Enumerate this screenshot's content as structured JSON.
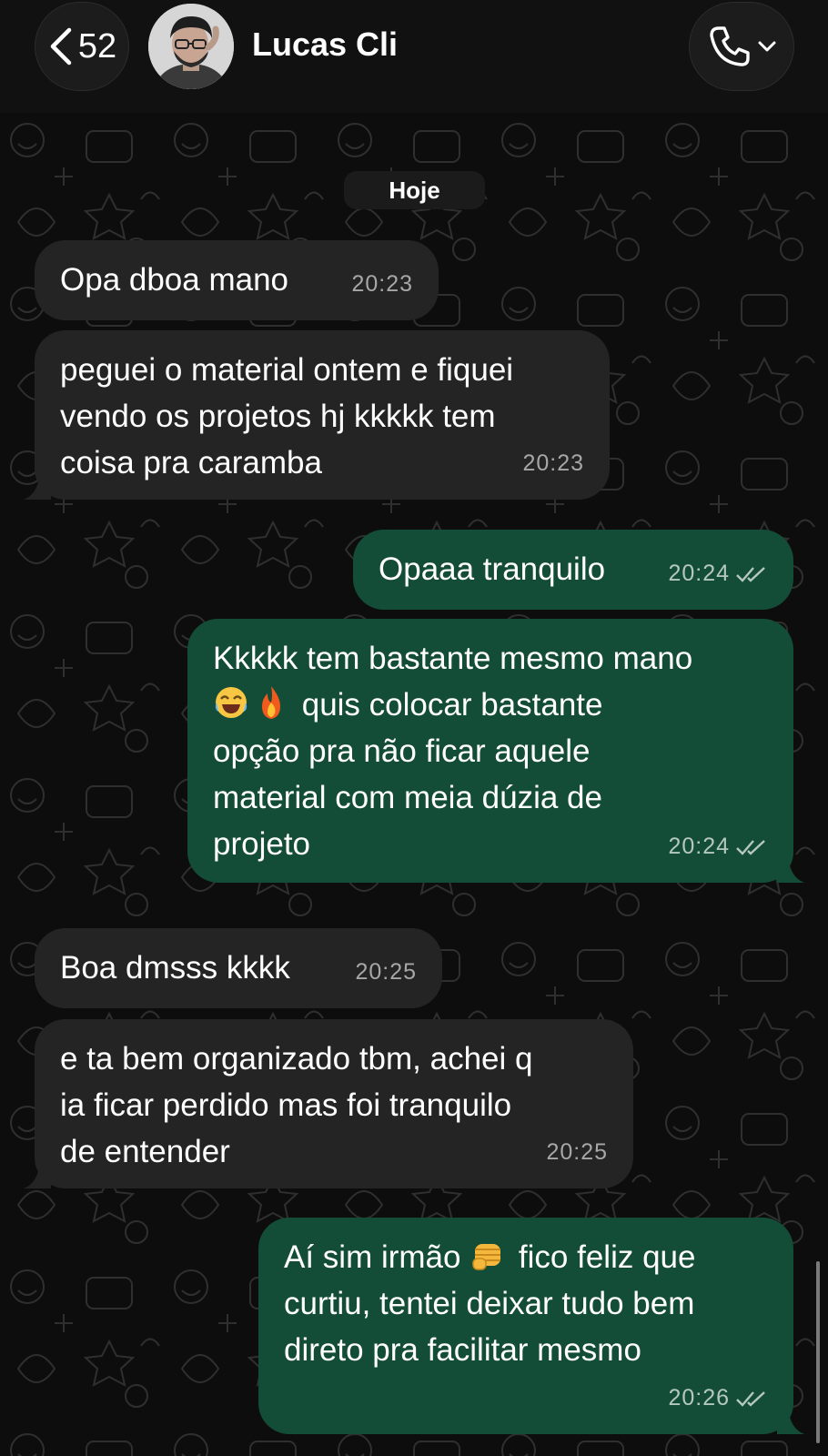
{
  "header": {
    "back_count": "52",
    "contact_name": "Lucas Cli",
    "back_icon": "chevron-left-icon",
    "call_icon": "phone-icon"
  },
  "chat": {
    "date_label": "Hoje",
    "messages": [
      {
        "direction": "in",
        "text": "Opa dboa mano",
        "time": "20:23"
      },
      {
        "direction": "in",
        "text": "peguei o material ontem e fiquei\nvendo os projetos hj kkkkk tem\ncoisa pra caramba",
        "time": "20:23"
      },
      {
        "direction": "out",
        "text": "Opaaa tranquilo",
        "time": "20:24",
        "status": "read"
      },
      {
        "direction": "out",
        "text_line1": "Kkkkk tem bastante mesmo mano",
        "emojis": [
          "😂",
          "🔥"
        ],
        "text_rest": " quis colocar bastante\nopção pra não ficar aquele\nmaterial com meia dúzia de\nprojeto",
        "time": "20:24",
        "status": "read"
      },
      {
        "direction": "in",
        "text": "Boa dmsss kkkk",
        "time": "20:25"
      },
      {
        "direction": "in",
        "text": "e ta bem organizado tbm, achei q\nia ficar perdido mas foi tranquilo\nde entender",
        "time": "20:25"
      },
      {
        "direction": "out",
        "text_before": "Aí sim irmão ",
        "emoji": "👊",
        "text_after": " fico feliz que\ncurtiu, tentei deixar tudo bem\ndireto pra facilitar mesmo",
        "time": "20:26",
        "status": "read"
      }
    ]
  },
  "colors": {
    "incoming_bubble": "#242424",
    "outgoing_bubble": "#144d37",
    "background": "#0d0d0d"
  }
}
